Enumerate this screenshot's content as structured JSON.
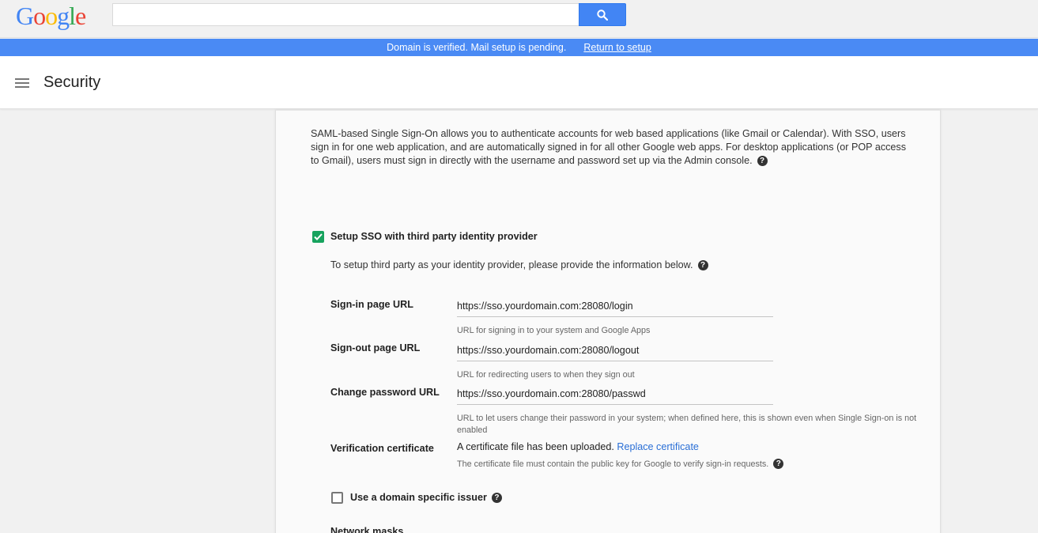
{
  "logo": {
    "letters": [
      "G",
      "o",
      "o",
      "g",
      "l",
      "e"
    ]
  },
  "search": {
    "value": "",
    "placeholder": ""
  },
  "banner": {
    "message": "Domain is verified. Mail setup is pending.",
    "link": "Return to setup"
  },
  "header": {
    "title": "Security"
  },
  "sso": {
    "description": "SAML-based Single Sign-On allows you to authenticate accounts for web based applications (like Gmail or Calendar). With SSO, users sign in for one web application, and are automatically signed in for all other Google web apps. For desktop applications (or POP access to Gmail), users must sign in directly with the username and password set up via the Admin console.",
    "setup_checkbox_label": "Setup SSO with third party identity provider",
    "setup_checked": true,
    "intro": "To setup third party as your identity provider, please provide the information below.",
    "fields": [
      {
        "label": "Sign-in page URL",
        "value": "https://sso.yourdomain.com:28080/login",
        "hint": "URL for signing in to your system and Google Apps"
      },
      {
        "label": "Sign-out page URL",
        "value": "https://sso.yourdomain.com:28080/logout",
        "hint": "URL for redirecting users to when they sign out"
      },
      {
        "label": "Change password URL",
        "value": "https://sso.yourdomain.com:28080/passwd",
        "hint": "URL to let users change their password in your system; when defined here, this is shown even when Single Sign-on is not enabled"
      }
    ],
    "certificate": {
      "label": "Verification certificate",
      "status": "A certificate file has been uploaded.",
      "replace_link": "Replace certificate",
      "hint": "The certificate file must contain the public key for Google to verify sign-in requests."
    },
    "domain_issuer_label": "Use a domain specific issuer",
    "domain_issuer_checked": false,
    "network_masks_label": "Network masks"
  },
  "colors": {
    "accent": "#4285f4",
    "banner": "#4a8af4",
    "checkbox": "#17a35e",
    "link": "#2a6fd6"
  }
}
